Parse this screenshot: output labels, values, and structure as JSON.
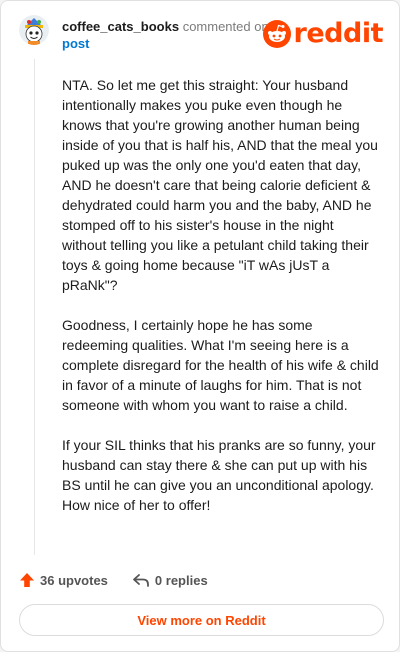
{
  "header": {
    "username": "coffee_cats_books",
    "commented_text": "commented on",
    "post_link": "post",
    "logo_text": "reddit"
  },
  "comment": {
    "paragraphs": [
      "NTA. So let me get this straight: Your husband intentionally makes you puke even though he knows that you're growing another human being inside of you that is half his, AND that the meal you puked up was the only one you'd eaten that day, AND he doesn't care that being calorie deficient & dehydrated could harm you and the baby, AND he stomped off to his sister's house in the night without telling you like a petulant child taking their toys & going home because \"iT wAs jUsT a pRaNk\"?",
      "Goodness, I certainly hope he has some redeeming qualities. What I'm seeing here is a complete disregard for the health of his wife & child in favor of a minute of laughs for him. That is not someone with whom you want to raise a child.",
      "If your SIL thinks that his pranks are so funny, your husband can stay there & she can put up with his BS until he can give you an unconditional apology. How nice of her to offer!"
    ]
  },
  "actions": {
    "upvotes": "36 upvotes",
    "replies": "0 replies"
  },
  "footer": {
    "view_more": "View more on Reddit"
  },
  "icons": {
    "logo": "reddit-snoo-icon",
    "upvote": "upvote-arrow-icon",
    "reply": "reply-arrow-icon",
    "avatar": "avatar"
  },
  "colors": {
    "brand": "#ff4500",
    "link": "#0079d3",
    "muted": "#7c7c7c"
  }
}
